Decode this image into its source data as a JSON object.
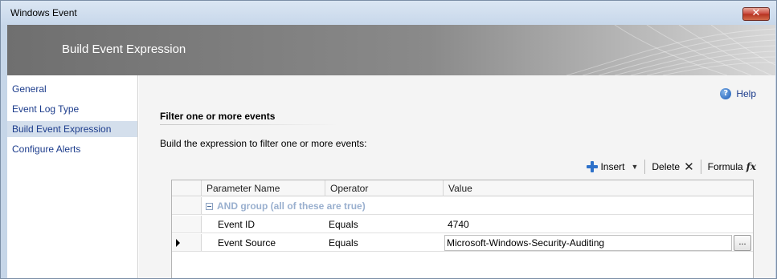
{
  "window": {
    "title": "Windows Event",
    "close_label": "✕"
  },
  "banner": {
    "title": "Build Event Expression"
  },
  "sidebar": {
    "items": [
      {
        "label": "General"
      },
      {
        "label": "Event Log Type"
      },
      {
        "label": "Build Event Expression",
        "active": true
      },
      {
        "label": "Configure Alerts"
      }
    ]
  },
  "main": {
    "help_label": "Help",
    "section_title": "Filter one or more events",
    "description": "Build the expression to filter one or more events:"
  },
  "toolbar": {
    "insert_label": "Insert",
    "delete_label": "Delete",
    "formula_label": "Formula"
  },
  "grid": {
    "columns": [
      "Parameter Name",
      "Operator",
      "Value"
    ],
    "group_label": "AND group (all of these are true)",
    "rows": [
      {
        "parameter": "Event ID",
        "operator": "Equals",
        "value": "4740"
      },
      {
        "parameter": "Event Source",
        "operator": "Equals",
        "value": "Microsoft-Windows-Security-Auditing",
        "ellipsis": "..."
      }
    ]
  }
}
